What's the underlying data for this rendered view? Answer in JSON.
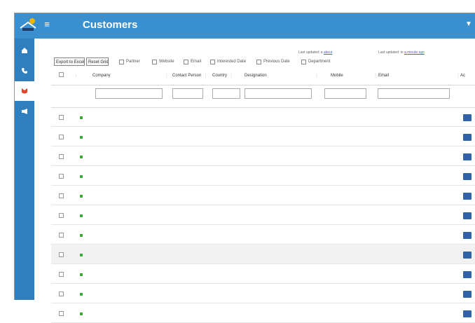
{
  "app": {
    "title": "Customers",
    "hamburger_glyph": "≡",
    "topbar_right_glyph": "▼",
    "accent_color": "#3a8fcf",
    "sidebar_color": "#2f7fbf",
    "logo_icon": "app-logo"
  },
  "sidebar": {
    "items": [
      {
        "name": "home",
        "icon": "home-icon",
        "active": false
      },
      {
        "name": "phone",
        "icon": "phone-icon",
        "active": false
      },
      {
        "name": "customers",
        "icon": "shield-icon",
        "active": true
      },
      {
        "name": "campaigns",
        "icon": "megaphone-icon",
        "active": false
      }
    ]
  },
  "toolbar": {
    "export_excel_label": "Export to Excel",
    "reset_grid_label": "Reset Grid",
    "checkbox_filters": [
      "Partner",
      "Website",
      "Email",
      "Interested Date",
      "Previous Date",
      "Department"
    ],
    "last_updated_1_label": "Last updated: a",
    "last_updated_1_link": "about",
    "last_updated_2_label": "Last updated: in",
    "last_updated_2_link": "a minute ago"
  },
  "table": {
    "columns": [
      "Company",
      "Contact Person",
      "Country",
      "Designation",
      "Mobile",
      "Email",
      "Ac"
    ],
    "rows": [
      {
        "company": "",
        "contact": "",
        "country": "",
        "designation": "",
        "mobile": "",
        "email": "",
        "highlight": false
      },
      {
        "company": "",
        "contact": "",
        "country": "",
        "designation": "",
        "mobile": "",
        "email": "",
        "highlight": false
      },
      {
        "company": "",
        "contact": "",
        "country": "",
        "designation": "",
        "mobile": "",
        "email": "",
        "highlight": false
      },
      {
        "company": "",
        "contact": "",
        "country": "",
        "designation": "",
        "mobile": "",
        "email": "",
        "highlight": false
      },
      {
        "company": "",
        "contact": "",
        "country": "",
        "designation": "",
        "mobile": "",
        "email": "",
        "highlight": false
      },
      {
        "company": "",
        "contact": "",
        "country": "",
        "designation": "",
        "mobile": "",
        "email": "",
        "highlight": false
      },
      {
        "company": "",
        "contact": "",
        "country": "",
        "designation": "",
        "mobile": "",
        "email": "",
        "highlight": false
      },
      {
        "company": "",
        "contact": "",
        "country": "",
        "designation": "",
        "mobile": "",
        "email": "",
        "highlight": true
      },
      {
        "company": "",
        "contact": "",
        "country": "",
        "designation": "",
        "mobile": "",
        "email": "",
        "highlight": false
      },
      {
        "company": "",
        "contact": "",
        "country": "",
        "designation": "",
        "mobile": "",
        "email": "",
        "highlight": false
      },
      {
        "company": "",
        "contact": "",
        "country": "",
        "designation": "",
        "mobile": "",
        "email": "",
        "highlight": false
      }
    ]
  },
  "colors": {
    "row_status_green": "#3aaa35",
    "action_button": "#2f62a8",
    "company_text": "#c0392b"
  }
}
